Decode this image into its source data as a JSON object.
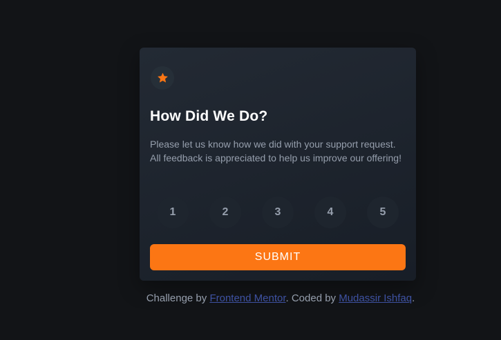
{
  "card": {
    "title": "How Did We Do?",
    "description": "Please let us know how we did with your support request. All feedback is appreciated to help us improve our offering!",
    "ratings": [
      "1",
      "2",
      "3",
      "4",
      "5"
    ],
    "submit_label": "SUBMIT",
    "icon": "star-icon"
  },
  "attribution": {
    "prefix": "Challenge by ",
    "link1": "Frontend Mentor",
    "middle": ". Coded by ",
    "link2": "Mudassir Ishfaq",
    "suffix": "."
  },
  "colors": {
    "background": "#121417",
    "accent": "#fc7614",
    "link": "#3e52a3",
    "text_muted": "#969fad"
  }
}
